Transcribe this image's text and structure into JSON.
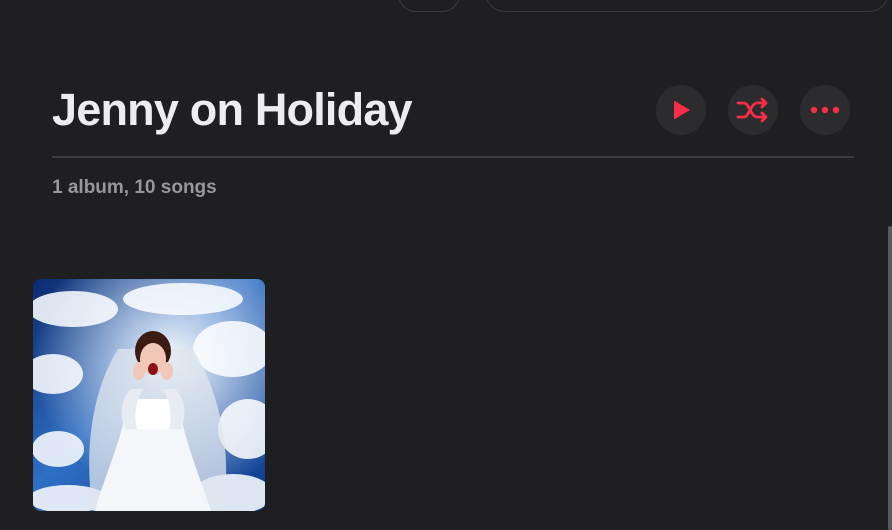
{
  "artist": {
    "name": "Jenny on Holiday",
    "summary": "1 album, 10 songs"
  },
  "actions": {
    "play_icon": "play-icon",
    "shuffle_icon": "shuffle-icon",
    "more_icon": "ellipsis-icon"
  },
  "colors": {
    "accent": "#fa2d48",
    "background": "#1f1f21",
    "button_background": "#2c2c2f",
    "secondary_text": "#96969b"
  },
  "albums": [
    {
      "artwork": "album-artwork-bride-in-clouds"
    }
  ]
}
